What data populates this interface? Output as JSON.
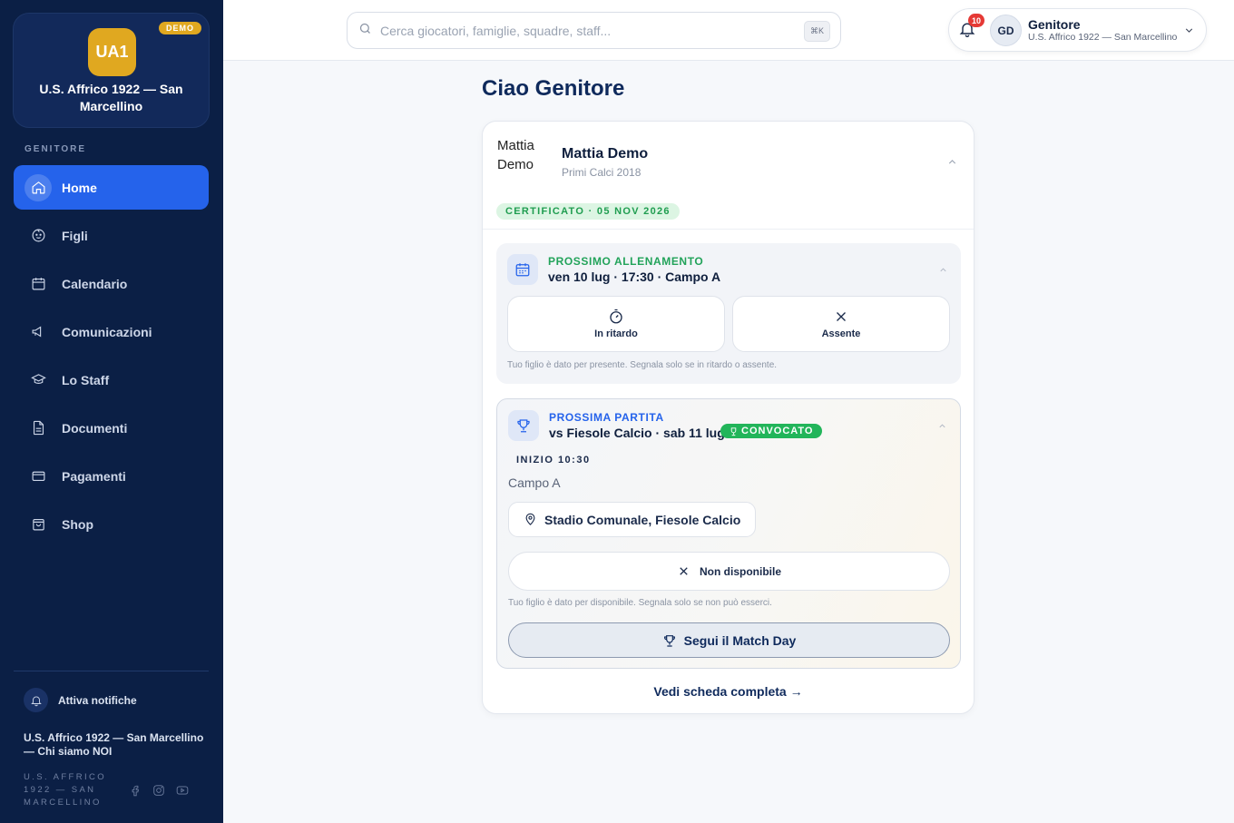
{
  "club": {
    "logo_text": "UA1",
    "demo_label": "DEMO",
    "name": "U.S. Affrico 1922 — San Marcellino"
  },
  "sidebar": {
    "role_label": "GENITORE",
    "items": [
      {
        "label": "Home",
        "icon": "home-icon"
      },
      {
        "label": "Figli",
        "icon": "baby-face-icon"
      },
      {
        "label": "Calendario",
        "icon": "calendar-icon"
      },
      {
        "label": "Comunicazioni",
        "icon": "megaphone-icon"
      },
      {
        "label": "Lo Staff",
        "icon": "graduation-cap-icon"
      },
      {
        "label": "Documenti",
        "icon": "document-icon"
      },
      {
        "label": "Pagamenti",
        "icon": "credit-card-icon"
      },
      {
        "label": "Shop",
        "icon": "shopping-bag-icon"
      }
    ],
    "notifications_label": "Attiva notifiche",
    "footer_title": "U.S. Affrico 1922 — San Marcellino — Chi siamo NOI",
    "footer_small": "U.S. AFFRICO 1922 — SAN MARCELLINO"
  },
  "search": {
    "placeholder": "Cerca giocatori, famiglie, squadre, staff...",
    "shortcut": "⌘K"
  },
  "user": {
    "notification_count": "10",
    "initials": "GD",
    "name": "Genitore",
    "club": "U.S. Affrico 1922 — San Marcellino"
  },
  "main": {
    "greeting": "Ciao Genitore",
    "child": {
      "photo_alt": "Mattia Demo",
      "name": "Mattia Demo",
      "team": "Primi Calci 2018",
      "certificate": "CERTIFICATO · 05 NOV 2026"
    },
    "training": {
      "label": "PROSSIMO ALLENAMENTO",
      "title": "ven 10 lug · 17:30 · Campo A",
      "late_label": "In ritardo",
      "absent_label": "Assente",
      "hint": "Tuo figlio è dato per presente. Segnala solo se in ritardo o assente."
    },
    "match": {
      "label": "PROSSIMA PARTITA",
      "title": "vs Fiesole Calcio · sab 11 lug",
      "badge": "CONVOCATO",
      "start": "INIZIO 10:30",
      "field": "Campo A",
      "venue": "Stadio Comunale, Fiesole Calcio",
      "unavailable_label": "Non disponibile",
      "hint": "Tuo figlio è dato per disponibile. Segnala solo se non può esserci.",
      "match_day_label": "Segui il Match Day"
    },
    "full_link": "Vedi scheda completa →"
  },
  "colors": {
    "sidebar_bg": "#0b1f45",
    "accent": "#2563eb",
    "gold": "#e0a820",
    "success": "#22b55a",
    "danger": "#e53935"
  }
}
